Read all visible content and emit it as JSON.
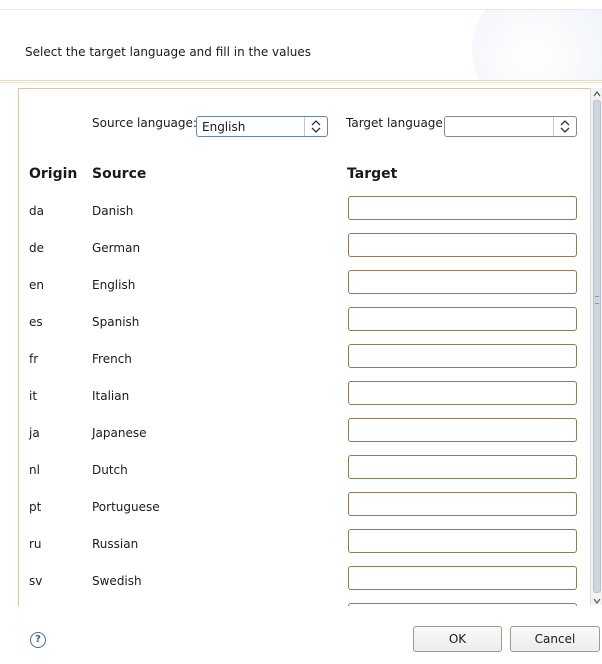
{
  "header": {
    "message": "Select the target language and fill in the values"
  },
  "controls": {
    "source_language_label": "Source language:",
    "source_language_value": "English",
    "target_language_label": "Target language:",
    "target_language_value": ""
  },
  "table": {
    "columns": [
      "Origin",
      "Source",
      "Target"
    ],
    "rows": [
      {
        "code": "da",
        "name": "Danish",
        "target": ""
      },
      {
        "code": "de",
        "name": "German",
        "target": ""
      },
      {
        "code": "en",
        "name": "English",
        "target": ""
      },
      {
        "code": "es",
        "name": "Spanish",
        "target": ""
      },
      {
        "code": "fr",
        "name": "French",
        "target": ""
      },
      {
        "code": "it",
        "name": "Italian",
        "target": ""
      },
      {
        "code": "ja",
        "name": "Japanese",
        "target": ""
      },
      {
        "code": "nl",
        "name": "Dutch",
        "target": ""
      },
      {
        "code": "pt",
        "name": "Portuguese",
        "target": ""
      },
      {
        "code": "ru",
        "name": "Russian",
        "target": ""
      },
      {
        "code": "sv",
        "name": "Swedish",
        "target": ""
      }
    ]
  },
  "footer": {
    "help_glyph": "?",
    "ok_label": "OK",
    "cancel_label": "Cancel"
  },
  "icons": {
    "help": "help-icon",
    "combo_arrow": "up-down-arrows-icon"
  },
  "colors": {
    "accent_border": "#d7c9a6",
    "input_border": "#8b7b5c",
    "help_blue": "#3d5f93"
  }
}
